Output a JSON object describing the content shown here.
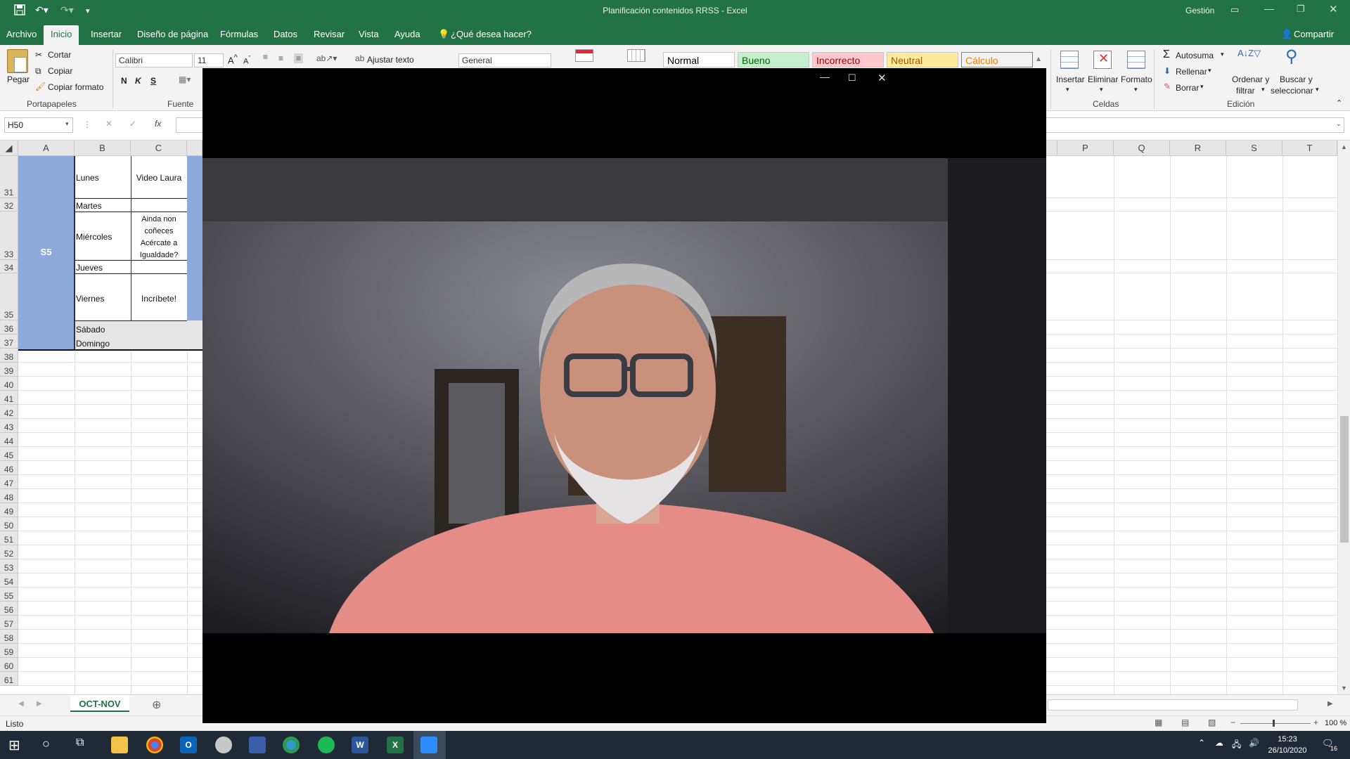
{
  "window": {
    "title": "Planificación contenidos RRSS  -  Excel",
    "user": "Gestión"
  },
  "tabs": [
    {
      "label": "Archivo"
    },
    {
      "label": "Inicio"
    },
    {
      "label": "Insertar"
    },
    {
      "label": "Diseño de página"
    },
    {
      "label": "Fórmulas"
    },
    {
      "label": "Datos"
    },
    {
      "label": "Revisar"
    },
    {
      "label": "Vista"
    },
    {
      "label": "Ayuda"
    }
  ],
  "tell_me": "¿Qué desea hacer?",
  "share": "Compartir",
  "ribbon": {
    "paste": "Pegar",
    "cut": "Cortar",
    "copy": "Copiar",
    "format_painter": "Copiar formato",
    "clipboard_group": "Portapapeles",
    "font_name": "Calibri",
    "font_size": "11",
    "bold": "N",
    "italic": "K",
    "underline": "S",
    "font_group": "Fuente",
    "wrap_text": "Ajustar texto",
    "number_format": "General",
    "styles": {
      "normal": "Normal",
      "good": "Bueno",
      "bad": "Incorrecto",
      "neutral": "Neutral",
      "calc": "Cálculo"
    },
    "cells_insert": "Insertar",
    "cells_delete": "Eliminar",
    "cells_format": "Formato",
    "cells_group": "Celdas",
    "autosum": "Autosuma",
    "fill": "Rellenar",
    "clear": "Borrar",
    "sort_filter_1": "Ordenar y",
    "sort_filter_2": "filtrar",
    "find_select_1": "Buscar y",
    "find_select_2": "seleccionar",
    "editing_group": "Edición"
  },
  "formula_bar": {
    "name_box": "H50",
    "fx": "fx"
  },
  "columns_left": [
    "A",
    "B",
    "C"
  ],
  "columns_right": [
    "P",
    "Q",
    "R",
    "S",
    "T"
  ],
  "rows": [
    "31",
    "32",
    "33",
    "34",
    "35",
    "36",
    "37",
    "38",
    "39",
    "40",
    "41",
    "42",
    "43",
    "44",
    "45",
    "46",
    "47",
    "48",
    "49",
    "50",
    "51",
    "52",
    "53",
    "54",
    "55",
    "56",
    "57",
    "58",
    "59",
    "60",
    "61"
  ],
  "sheet_cells": {
    "week": "S5",
    "lunes": "Lunes",
    "martes": "Martes",
    "miercoles": "Miércoles",
    "jueves": "Jueves",
    "viernes": "Viernes",
    "sabado": "Sábado",
    "domingo": "Domingo",
    "c_lunes": "Video Laura",
    "c_miercoles_1": "Ainda non",
    "c_miercoles_2": "coñeces",
    "c_miercoles_3": "Acércate a",
    "c_miercoles_4": "Igualdade?",
    "c_viernes": "Incríbete!"
  },
  "sheet_tab": "OCT-NOV",
  "status": {
    "ready": "Listo",
    "zoom": "100 %"
  },
  "taskbar": {
    "time": "15:23",
    "date": "26/10/2020",
    "notifications": "16"
  },
  "colors": {
    "excel_green": "#217346",
    "week_fill": "#8ea9db",
    "taskbar": "#1f2a36"
  }
}
